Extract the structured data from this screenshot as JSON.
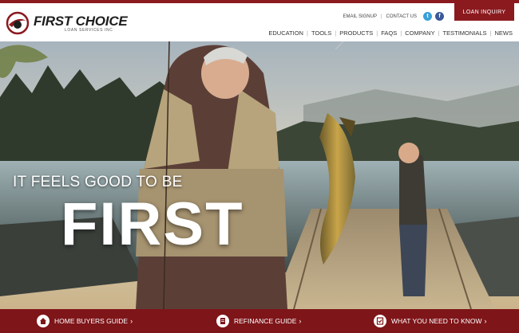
{
  "brand": {
    "name": "FIRST CHOICE",
    "subtitle": "LOAN SERVICES INC",
    "accent": "#8b1a1f"
  },
  "utility": {
    "email_signup": "EMAIL SIGNUP",
    "separator": "|",
    "contact_us": "CONTACT US",
    "twitter_icon": "twitter-icon",
    "facebook_icon": "facebook-icon"
  },
  "cta": {
    "label": "LOAN INQUIRY"
  },
  "nav": {
    "separator": "|",
    "items": [
      {
        "label": "EDUCATION"
      },
      {
        "label": "TOOLS"
      },
      {
        "label": "PRODUCTS"
      },
      {
        "label": "FAQS"
      },
      {
        "label": "COMPANY"
      },
      {
        "label": "TESTIMONIALS"
      },
      {
        "label": "NEWS"
      }
    ]
  },
  "hero": {
    "line1": "IT FEELS GOOD TO BE",
    "line2": "FIRST"
  },
  "bottom": {
    "items": [
      {
        "label": "HOME BUYERS GUIDE",
        "chevron": "›",
        "icon": "home-icon"
      },
      {
        "label": "REFINANCE GUIDE",
        "chevron": "›",
        "icon": "document-icon"
      },
      {
        "label": "WHAT YOU NEED TO KNOW",
        "chevron": "›",
        "icon": "checklist-icon"
      }
    ]
  }
}
